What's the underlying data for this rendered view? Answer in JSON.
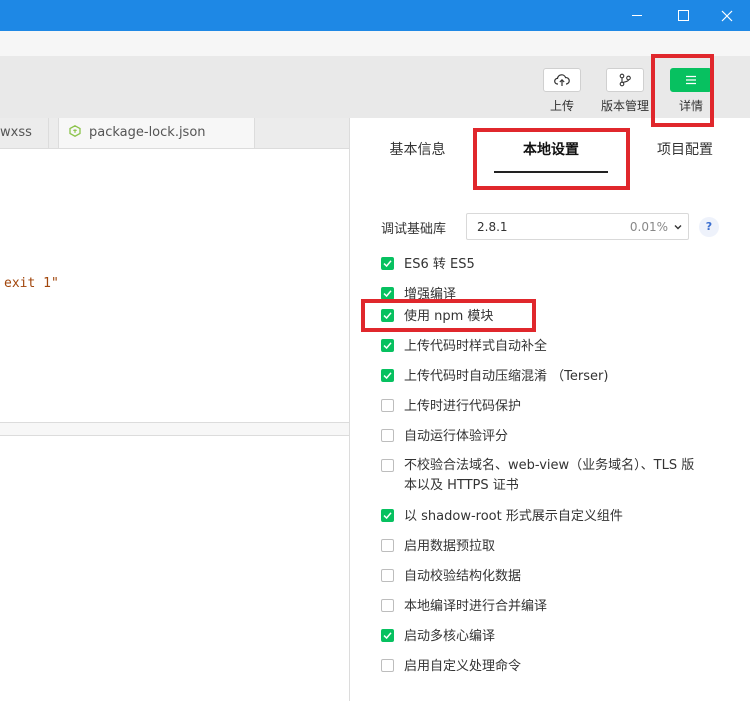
{
  "colors": {
    "titlebar": "#1e88e5",
    "accent_green": "#07c160",
    "highlight_red": "#e0272c"
  },
  "toolbar": {
    "upload_label": "上传",
    "version_label": "版本管理",
    "detail_label": "详情"
  },
  "editor": {
    "tabs": [
      {
        "label": "wxss"
      },
      {
        "label": "package-lock.json"
      }
    ],
    "code_line": "exit 1\""
  },
  "panel": {
    "tabs": [
      {
        "label": "基本信息"
      },
      {
        "label": "本地设置"
      },
      {
        "label": "项目配置"
      }
    ],
    "active_tab": "本地设置",
    "lib_label": "调试基础库",
    "lib_version": "2.8.1",
    "lib_percent": "0.01%",
    "help_label": "?",
    "options": [
      {
        "label": "ES6 转 ES5",
        "checked": true
      },
      {
        "label": "增强编译",
        "checked": true
      },
      {
        "label": "使用 npm 模块",
        "checked": true
      },
      {
        "label": "上传代码时样式自动补全",
        "checked": true
      },
      {
        "label": "上传代码时自动压缩混淆 （Terser)",
        "checked": true
      },
      {
        "label": "上传时进行代码保护",
        "checked": false
      },
      {
        "label": "自动运行体验评分",
        "checked": false
      },
      {
        "label": "不校验合法域名、web-view（业务域名）、TLS 版本以及 HTTPS 证书",
        "checked": false
      },
      {
        "label": "以 shadow-root 形式展示自定义组件",
        "checked": true
      },
      {
        "label": "启用数据预拉取",
        "checked": false
      },
      {
        "label": "自动校验结构化数据",
        "checked": false
      },
      {
        "label": "本地编译时进行合并编译",
        "checked": false
      },
      {
        "label": "启动多核心编译",
        "checked": true
      },
      {
        "label": "启用自定义处理命令",
        "checked": false
      }
    ]
  }
}
